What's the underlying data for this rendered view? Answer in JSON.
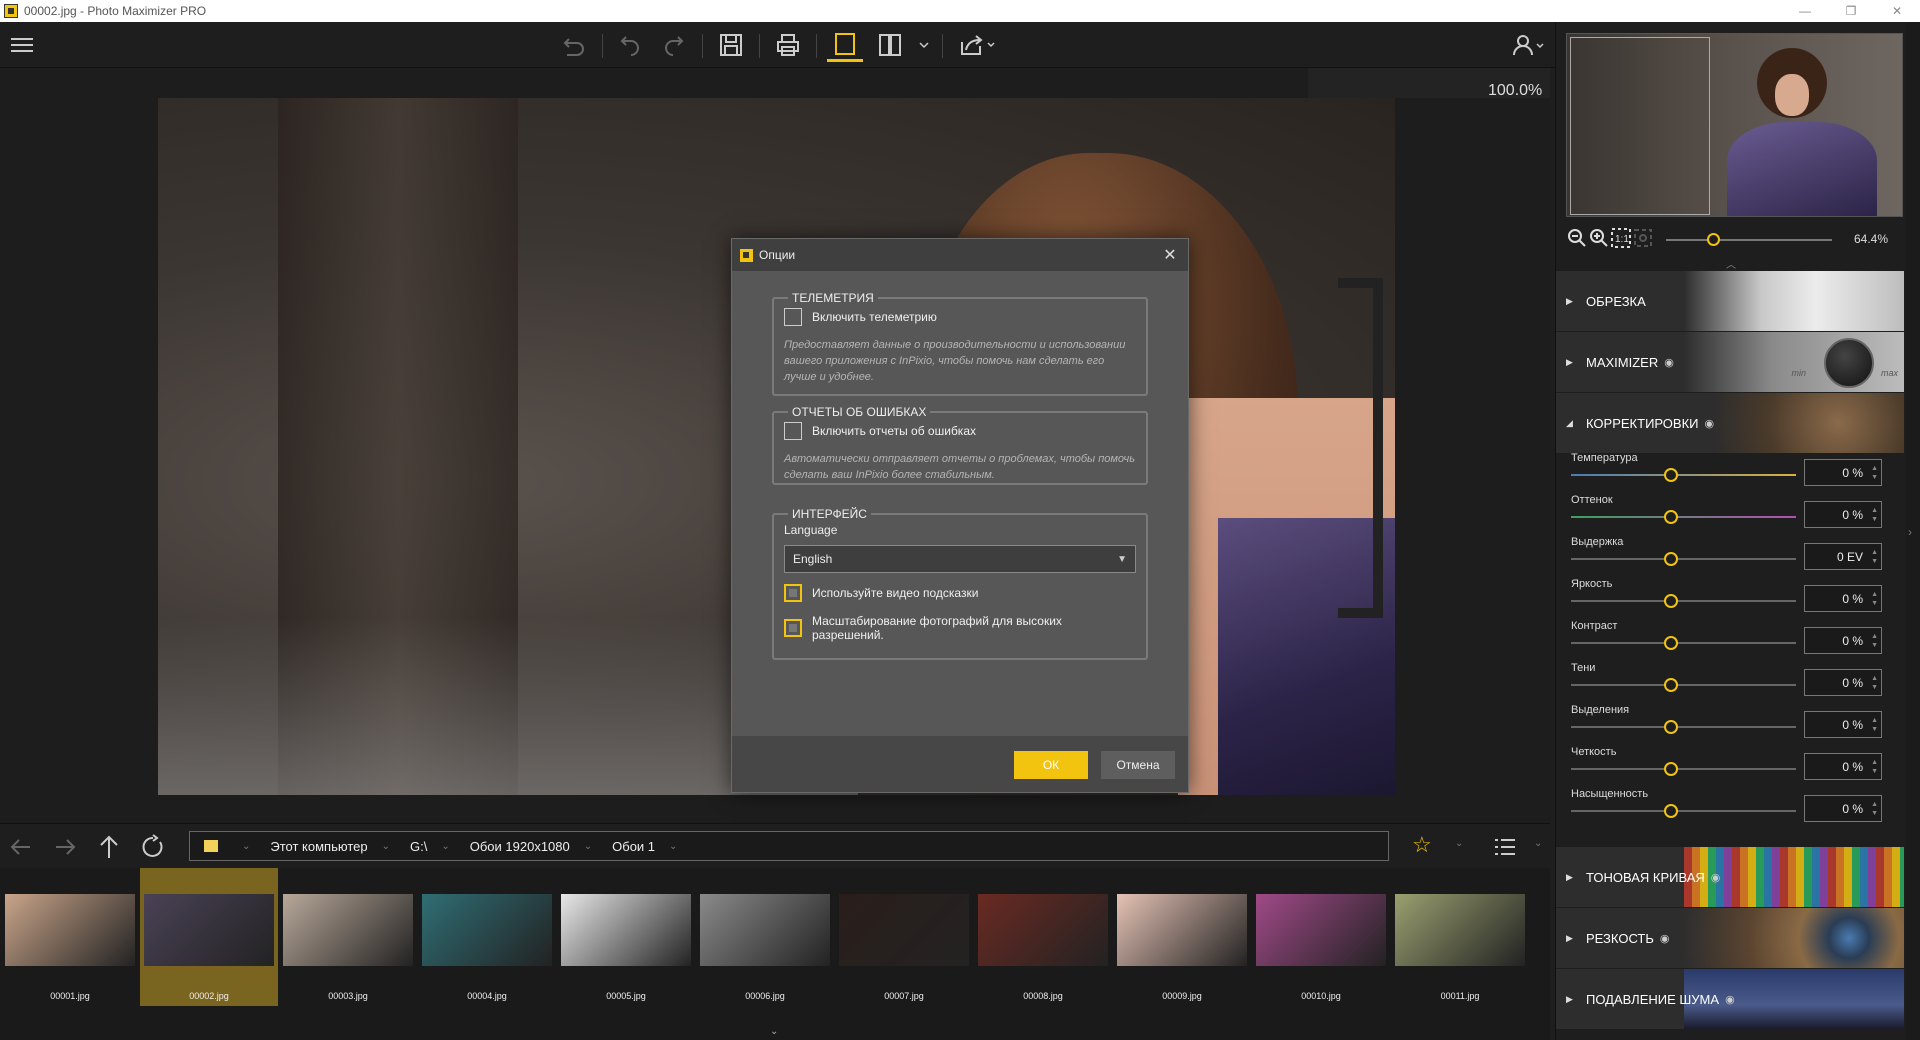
{
  "window": {
    "title": "00002.jpg - Photo Maximizer PRO",
    "controls": [
      "—",
      "❐",
      "✕"
    ]
  },
  "toolbar": {
    "icons": [
      "menu-icon",
      "undo-all-icon",
      "undo-icon",
      "redo-icon",
      "save-icon",
      "print-icon",
      "single-view-icon",
      "split-view-icon",
      "share-icon",
      "user-icon"
    ]
  },
  "canvas": {
    "zoom": "100.0%"
  },
  "dialog": {
    "title": "Опции",
    "close": "✕",
    "telemetry": {
      "legend": "ТЕЛЕМЕТРИЯ",
      "checkbox_label": "Включить телеметрию",
      "checked": false,
      "description": "Предоставляет данные о производительности и использовании вашего приложения с InPixio, чтобы помочь нам сделать его лучше и удобнее."
    },
    "errors": {
      "legend": "ОТЧЕТЫ ОБ ОШИБКАХ",
      "checkbox_label": "Включить отчеты об ошибках",
      "checked": false,
      "description": "Автоматически отправляет отчеты о проблемах, чтобы помочь сделать ваш InPixio более стабильным."
    },
    "interface": {
      "legend": "ИНТЕРФЕЙС",
      "language_label": "Language",
      "language_value": "English",
      "video_hints_label": "Используйте видео подсказки",
      "scaling_label": "Масштабирование фотографий для высоких разрешений."
    },
    "ok_label": "ОК",
    "cancel_label": "Отмена"
  },
  "navbar": {
    "path": [
      "Этот компьютер",
      "G:\\",
      "Обои 1920x1080",
      "Обои 1"
    ]
  },
  "filmstrip": {
    "selected_index": 1,
    "thumbs": [
      {
        "label": "00001.jpg",
        "color": "#c9a58a"
      },
      {
        "label": "00002.jpg",
        "color": "#4a4256"
      },
      {
        "label": "00003.jpg",
        "color": "#b8a89a"
      },
      {
        "label": "00004.jpg",
        "color": "#2f6e74"
      },
      {
        "label": "00005.jpg",
        "color": "#e8e8e8"
      },
      {
        "label": "00006.jpg",
        "color": "#8a8a8a"
      },
      {
        "label": "00007.jpg",
        "color": "#2a1e1a"
      },
      {
        "label": "00008.jpg",
        "color": "#6a2a22"
      },
      {
        "label": "00009.jpg",
        "color": "#e5c3b5"
      },
      {
        "label": "00010.jpg",
        "color": "#a04a88"
      },
      {
        "label": "00011.jpg",
        "color": "#9aa070"
      }
    ]
  },
  "right_panel": {
    "nav_zoom": "64.4%",
    "nav_zoom_level": 0.29,
    "sections": [
      {
        "label": "ОБРЕЗКА",
        "expanded": false,
        "eye": false
      },
      {
        "label": "MAXIMIZER",
        "expanded": false,
        "eye": true,
        "min": "min",
        "max": "max"
      },
      {
        "label": "КОРРЕКТИРОВКИ",
        "expanded": true,
        "eye": true
      },
      {
        "label": "ТОНОВАЯ КРИВАЯ",
        "expanded": false,
        "eye": true
      },
      {
        "label": "РЕЗКОСТЬ",
        "expanded": false,
        "eye": true
      },
      {
        "label": "ПОДАВЛЕНИЕ ШУМА",
        "expanded": false,
        "eye": true
      }
    ],
    "adjustments": [
      {
        "name": "Температура",
        "value": "0 %"
      },
      {
        "name": "Оттенок",
        "value": "0 %"
      },
      {
        "name": "Выдержка",
        "value": "0 EV"
      },
      {
        "name": "Яркость",
        "value": "0 %"
      },
      {
        "name": "Контраст",
        "value": "0 %"
      },
      {
        "name": "Тени",
        "value": "0 %"
      },
      {
        "name": "Выделения",
        "value": "0 %"
      },
      {
        "name": "Четкость",
        "value": "0 %"
      },
      {
        "name": "Насыщенность",
        "value": "0 %"
      }
    ]
  },
  "colors": {
    "accent": "#f2c40f",
    "background": "#1e1e1e",
    "dialog": "#575757"
  }
}
